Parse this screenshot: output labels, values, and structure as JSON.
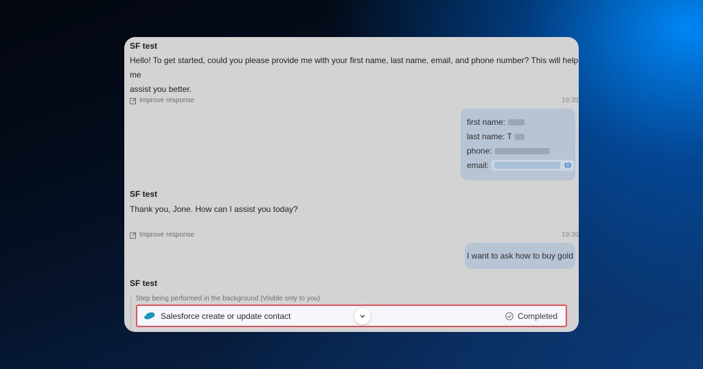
{
  "chat": {
    "messages": [
      {
        "sender": "SF test",
        "text_line1": "Hello! To get started, could you please provide me with your first name, last name, email, and phone number? This will help me",
        "text_line2": "assist you better.",
        "improve": "Improve response"
      },
      {
        "sender": "SF test",
        "text": "Thank you, Jone. How can I assist you today?",
        "improve": "Improve response"
      },
      {
        "sender": "SF test"
      }
    ],
    "timestamps": [
      "19:35",
      "19:36"
    ],
    "user_form": {
      "first_name_label": "first name:",
      "last_name_label": "last name: T",
      "phone_label": "phone:",
      "email_label": "email:"
    },
    "user_message_2": "I want to ask how to buy gold",
    "step": {
      "note": "Step being performed in the background (Visible only to you)",
      "action_label": "Salesforce create or update contact",
      "status": "Completed"
    }
  },
  "colors": {
    "card_bg": "#d3d3d3",
    "bubble_bg": "#b7c4d3",
    "highlight_border": "#e8505b",
    "salesforce_blue": "#1798c1"
  },
  "icons": [
    "edit-icon",
    "globe-icon",
    "salesforce-logo-icon",
    "chevron-down-icon",
    "check-circle-icon"
  ]
}
